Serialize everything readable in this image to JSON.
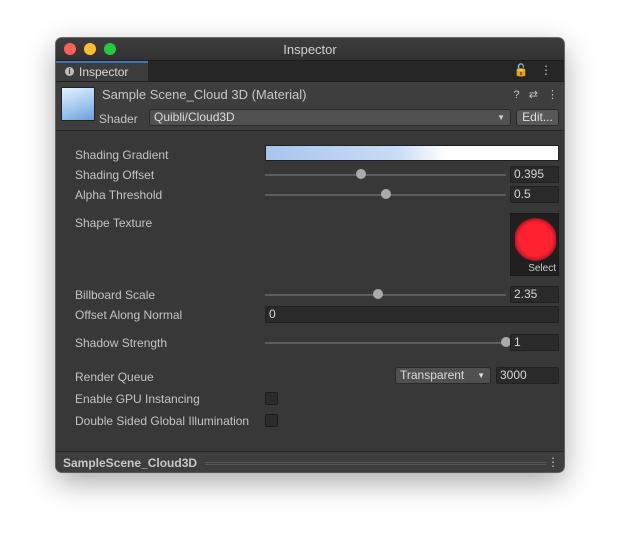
{
  "window": {
    "title": "Inspector"
  },
  "tab": {
    "label": "Inspector",
    "info_icon": "i"
  },
  "tab_icons": {
    "lock": "🔓",
    "more": "⋮"
  },
  "material": {
    "name": "Sample Scene_Cloud 3D (Material)"
  },
  "header_icons": {
    "help": "?",
    "settings": "⇄",
    "more": "⋮"
  },
  "shader": {
    "label": "Shader",
    "value": "Quibli/Cloud3D",
    "edit_label": "Edit..."
  },
  "props": {
    "shading_gradient": {
      "label": "Shading Gradient"
    },
    "shading_offset": {
      "label": "Shading Offset",
      "value": "0.395",
      "fraction": 0.4
    },
    "alpha_threshold": {
      "label": "Alpha Threshold",
      "value": "0.5",
      "fraction": 0.5
    },
    "shape_texture": {
      "label": "Shape Texture",
      "select_label": "Select"
    },
    "billboard_scale": {
      "label": "Billboard Scale",
      "value": "2.35",
      "fraction": 0.47
    },
    "offset_along_normal": {
      "label": "Offset Along Normal",
      "value": "0"
    },
    "shadow_strength": {
      "label": "Shadow Strength",
      "value": "1",
      "fraction": 1.0
    },
    "render_queue": {
      "label": "Render Queue",
      "mode": "Transparent",
      "value": "3000"
    },
    "gpu_instancing": {
      "label": "Enable GPU Instancing",
      "checked": false
    },
    "double_sided_gi": {
      "label": "Double Sided Global Illumination",
      "checked": false
    }
  },
  "footer": {
    "name": "SampleScene_Cloud3D",
    "more": "⋮"
  },
  "colors": {
    "accent": "#3a79bb",
    "panel": "#383838",
    "texture": "#ff2030"
  }
}
